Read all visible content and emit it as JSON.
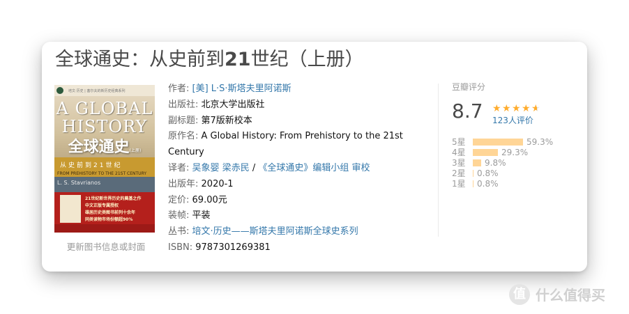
{
  "book": {
    "title_pre": "全球通史：从史前到",
    "title_num": "21",
    "title_post": "世纪（上册）"
  },
  "cover": {
    "top_text": "培文·历史 | 塞尔夫的新历史经典系列",
    "en_1": "A GLOBAL",
    "en_2": "HISTORY",
    "cn_title": "全球通史",
    "volume": "(上册)",
    "band_text": "从史前到21世纪",
    "subtitle_en": "FROM PREHISTORY TO THE 21ST CENTURY",
    "author": "L. S. Stavrianos",
    "red_line1": "21世纪新世界历史的奠基之作",
    "red_line2": "中文正版专属授权",
    "red_line3": "雄居历史类图书前列十余年",
    "red_line4": "同类读物市场份额超90%",
    "update_link": "更新图书信息或封面"
  },
  "info": {
    "author_label": "作者:",
    "author_value": "[美] L·S·斯塔夫里阿诺斯",
    "publisher_label": "出版社:",
    "publisher_value": "北京大学出版社",
    "subtitle_label": "副标题:",
    "subtitle_value": "第7版新校本",
    "original_label": "原作名:",
    "original_value_1": "A Global History: From Prehistory to the 21st",
    "original_value_2": "Century",
    "translator_label": "译者:",
    "translator_1": "吴象婴",
    "translator_2": "梁赤民",
    "translator_sep": " / ",
    "translator_3": "《全球通史》编辑小组",
    "translator_4": "审校",
    "year_label": "出版年:",
    "year_value": "2020-1",
    "price_label": "定价:",
    "price_value": "69.00元",
    "binding_label": "装帧:",
    "binding_value": "平装",
    "series_label": "丛书:",
    "series_value": "培文·历史——斯塔夫里阿诺斯全球史系列",
    "isbn_label": "ISBN:",
    "isbn_value": "9787301269381"
  },
  "rating": {
    "label": "豆瓣评分",
    "score": "8.7",
    "count": "123人评价",
    "star_color": "#ffac2d",
    "bar_color": "#ffd596",
    "stars_value": 4.5,
    "breakdown": [
      {
        "label": "5星",
        "percent": "59.3%",
        "value": 59.3
      },
      {
        "label": "4星",
        "percent": "29.3%",
        "value": 29.3
      },
      {
        "label": "3星",
        "percent": "9.8%",
        "value": 9.8
      },
      {
        "label": "2星",
        "percent": "0.8%",
        "value": 0.8
      },
      {
        "label": "1星",
        "percent": "0.8%",
        "value": 0.8
      }
    ]
  },
  "watermark": {
    "glyph": "值",
    "text": "什么值得买"
  }
}
